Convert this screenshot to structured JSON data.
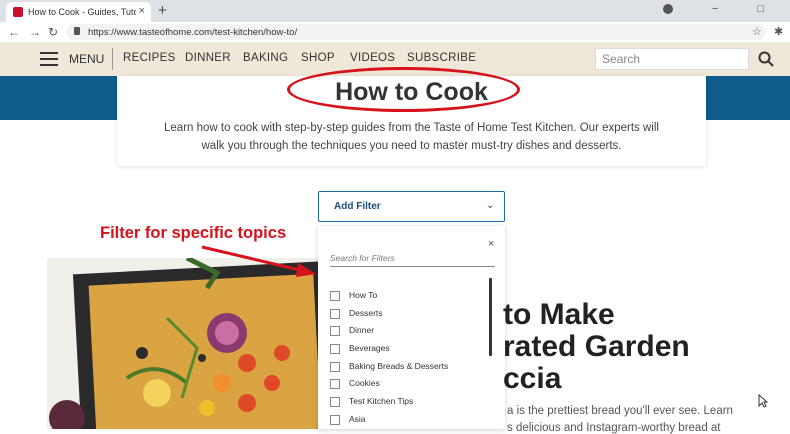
{
  "browser": {
    "tab_title": "How to Cook - Guides, Tutorials &",
    "tab_close": "×",
    "new_tab": "+",
    "url": "https://www.tasteofhome.com/test-kitchen/how-to/"
  },
  "site_nav": {
    "menu_label": "MENU",
    "items": [
      "RECIPES",
      "DINNER",
      "BAKING",
      "SHOP",
      "VIDEOS",
      "SUBSCRIBE"
    ],
    "search_placeholder": "Search"
  },
  "page": {
    "title": "How to Cook",
    "intro_line1": "Learn how to cook with step-by-step guides from the Taste of Home Test Kitchen. Our experts will",
    "intro_line2": "walk you through the techniques you need to master must-try dishes and desserts."
  },
  "filter": {
    "button_label": "Add Filter",
    "close": "×",
    "search_placeholder": "Search for Filters",
    "options": [
      "How To",
      "Desserts",
      "Dinner",
      "Beverages",
      "Baking Breads & Desserts",
      "Cookies",
      "Test Kitchen Tips",
      "Asia"
    ]
  },
  "annotation": {
    "label": "Filter for specific topics"
  },
  "article": {
    "title_lines": [
      "to Make",
      "rated Garden",
      "ccia"
    ],
    "body_lines": [
      "a is the prettiest bread you'll ever see. Learn",
      "s delicious and Instagram-worthy bread at"
    ]
  },
  "colors": {
    "header_bg": "#efe7d8",
    "banner": "#0e5c87",
    "annotation_red": "#d7121a",
    "filter_blue": "#1e6aa6"
  },
  "icons": [
    "favicon",
    "close-icon",
    "plus-icon",
    "back-arrow-icon",
    "forward-arrow-icon",
    "reload-icon",
    "lock-icon",
    "star-icon",
    "extensions-icon",
    "hamburger-icon",
    "search-icon",
    "chevron-down-icon"
  ]
}
